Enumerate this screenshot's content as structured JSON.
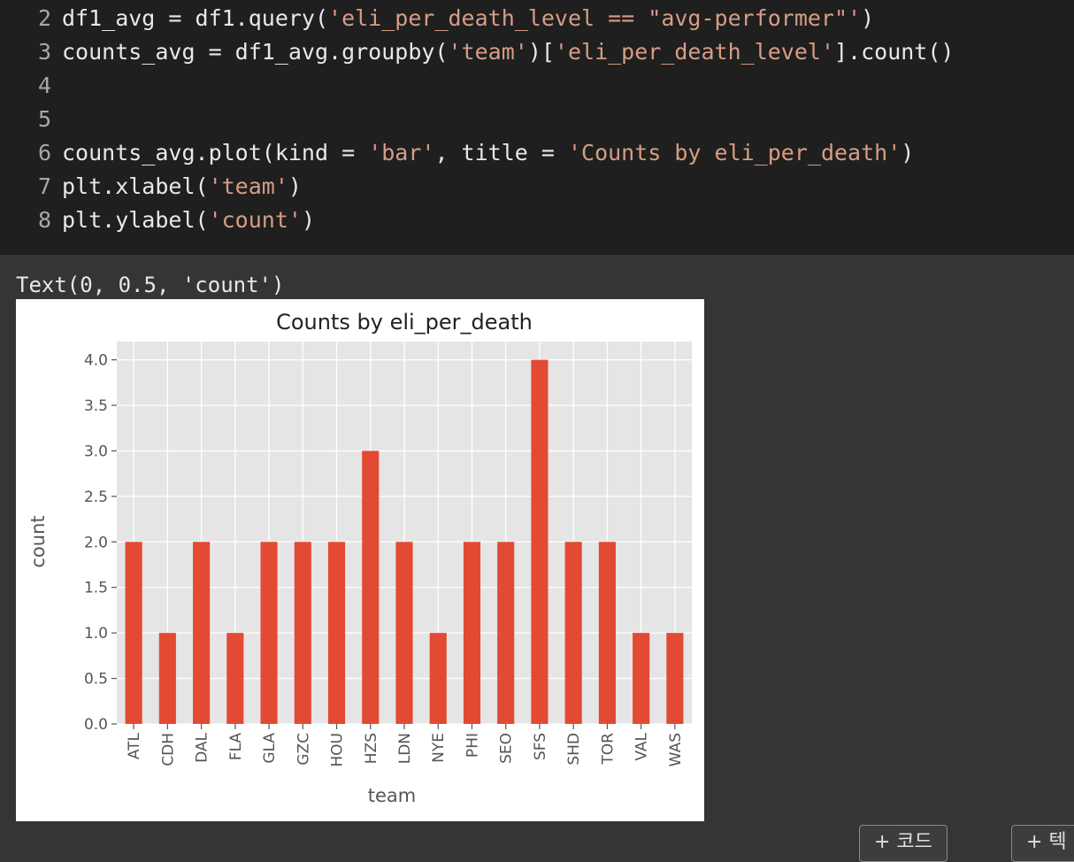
{
  "code": {
    "lines": [
      {
        "num": "2",
        "parts": [
          {
            "t": "df1_avg = df1.query(",
            "c": "code"
          },
          {
            "t": "'eli_per_death_level == \"avg-performer\"'",
            "c": "str"
          },
          {
            "t": ")",
            "c": "code"
          }
        ]
      },
      {
        "num": "3",
        "parts": [
          {
            "t": "counts_avg = df1_avg.groupby(",
            "c": "code"
          },
          {
            "t": "'team'",
            "c": "str"
          },
          {
            "t": ")[",
            "c": "code"
          },
          {
            "t": "'eli_per_death_level'",
            "c": "str"
          },
          {
            "t": "].count()",
            "c": "code"
          }
        ]
      },
      {
        "num": "4",
        "parts": []
      },
      {
        "num": "5",
        "parts": []
      },
      {
        "num": "6",
        "parts": [
          {
            "t": "counts_avg.plot(kind = ",
            "c": "code"
          },
          {
            "t": "'bar'",
            "c": "str"
          },
          {
            "t": ", title = ",
            "c": "code"
          },
          {
            "t": "'Counts by eli_per_death'",
            "c": "str"
          },
          {
            "t": ")",
            "c": "code"
          }
        ]
      },
      {
        "num": "7",
        "parts": [
          {
            "t": "plt.xlabel(",
            "c": "code"
          },
          {
            "t": "'team'",
            "c": "str"
          },
          {
            "t": ")",
            "c": "code"
          }
        ]
      },
      {
        "num": "8",
        "parts": [
          {
            "t": "plt.ylabel(",
            "c": "code"
          },
          {
            "t": "'count'",
            "c": "str"
          },
          {
            "t": ")",
            "c": "code"
          }
        ]
      }
    ]
  },
  "output": {
    "text": "Text(0, 0.5, 'count')"
  },
  "buttons": {
    "code_label": "+ 코드",
    "text_label": "+ 텍"
  },
  "colors": {
    "bar": "#e24a33",
    "plot_bg": "#e5e5e5",
    "grid": "#ffffff"
  },
  "chart_data": {
    "type": "bar",
    "title": "Counts by eli_per_death",
    "xlabel": "team",
    "ylabel": "count",
    "categories": [
      "ATL",
      "CDH",
      "DAL",
      "FLA",
      "GLA",
      "GZC",
      "HOU",
      "HZS",
      "LDN",
      "NYE",
      "PHI",
      "SEO",
      "SFS",
      "SHD",
      "TOR",
      "VAL",
      "WAS"
    ],
    "values": [
      2,
      1,
      2,
      1,
      2,
      2,
      2,
      3,
      2,
      1,
      2,
      2,
      4,
      2,
      2,
      1,
      1
    ],
    "ylim": [
      0,
      4.2
    ],
    "yticks": [
      "0.0",
      "0.5",
      "1.0",
      "1.5",
      "2.0",
      "2.5",
      "3.0",
      "3.5",
      "4.0"
    ],
    "grid": true,
    "style": "ggplot"
  }
}
